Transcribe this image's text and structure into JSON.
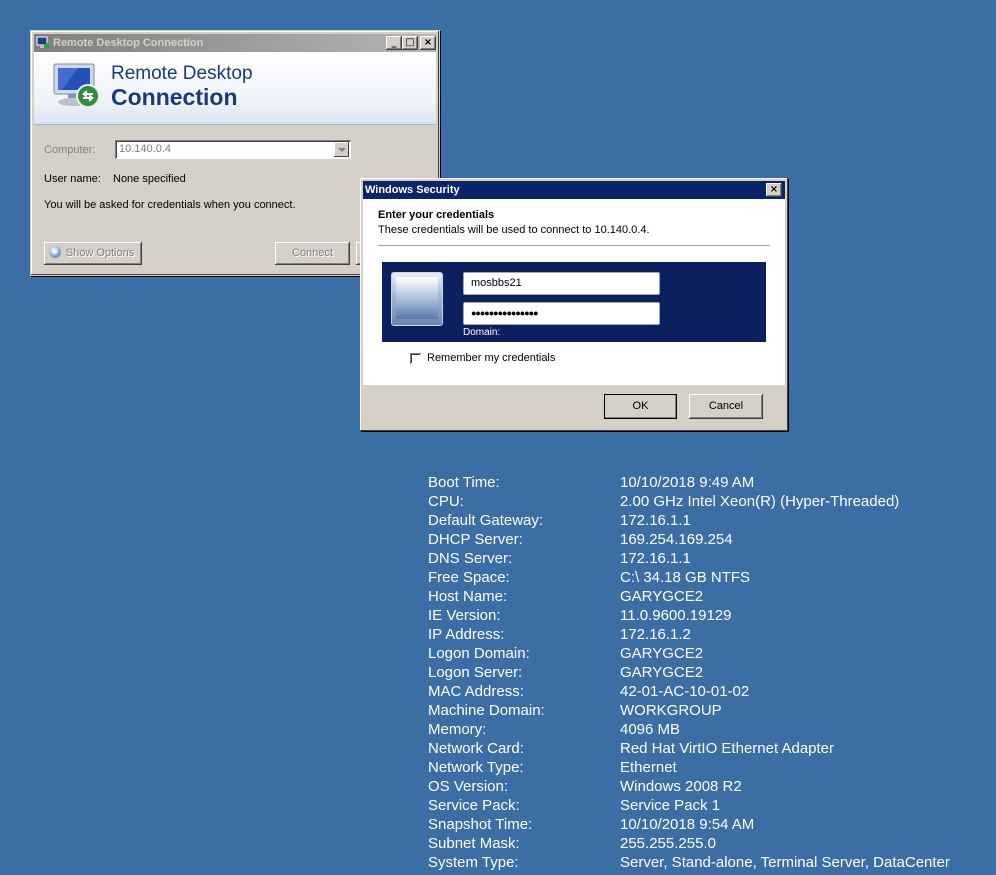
{
  "rdc": {
    "title": "Remote Desktop Connection",
    "banner_line1": "Remote Desktop",
    "banner_line2": "Connection",
    "computer_label": "Computer:",
    "computer_value": "10.140.0.4",
    "username_label": "User name:",
    "username_value": "None specified",
    "info_text": "You will be asked for credentials when you connect.",
    "show_options": "Show Options",
    "connect": "Connect",
    "minimize": "_",
    "maximize": "□",
    "close": "×"
  },
  "security": {
    "title": "Windows Security",
    "close": "×",
    "heading": "Enter your credentials",
    "subheading": "These credentials will be used to connect to 10.140.0.4.",
    "username": "mosbbs21",
    "password_mask": "●●●●●●●●●●●●●●●",
    "domain_label": "Domain:",
    "remember": "Remember my credentials",
    "ok": "OK",
    "cancel": "Cancel"
  },
  "bginfo": [
    {
      "key": "Boot Time:",
      "value": "10/10/2018 9:49 AM"
    },
    {
      "key": "CPU:",
      "value": "2.00 GHz Intel Xeon(R) (Hyper-Threaded)"
    },
    {
      "key": "Default Gateway:",
      "value": "172.16.1.1"
    },
    {
      "key": "DHCP Server:",
      "value": "169.254.169.254"
    },
    {
      "key": "DNS Server:",
      "value": "172.16.1.1"
    },
    {
      "key": "Free Space:",
      "value": "C:\\ 34.18 GB NTFS"
    },
    {
      "key": "Host Name:",
      "value": "GARYGCE2"
    },
    {
      "key": "IE Version:",
      "value": "11.0.9600.19129"
    },
    {
      "key": "IP Address:",
      "value": "172.16.1.2"
    },
    {
      "key": "Logon Domain:",
      "value": "GARYGCE2"
    },
    {
      "key": "Logon Server:",
      "value": "GARYGCE2"
    },
    {
      "key": "MAC Address:",
      "value": "42-01-AC-10-01-02"
    },
    {
      "key": "Machine Domain:",
      "value": "WORKGROUP"
    },
    {
      "key": "Memory:",
      "value": "4096 MB"
    },
    {
      "key": "Network Card:",
      "value": "Red Hat VirtIO Ethernet Adapter"
    },
    {
      "key": "Network Type:",
      "value": "Ethernet"
    },
    {
      "key": "OS Version:",
      "value": "Windows 2008 R2"
    },
    {
      "key": "Service Pack:",
      "value": "Service Pack 1"
    },
    {
      "key": "Snapshot Time:",
      "value": "10/10/2018 9:54 AM"
    },
    {
      "key": "Subnet Mask:",
      "value": "255.255.255.0"
    },
    {
      "key": "System Type:",
      "value": "Server, Stand-alone, Terminal Server, DataCenter"
    }
  ]
}
